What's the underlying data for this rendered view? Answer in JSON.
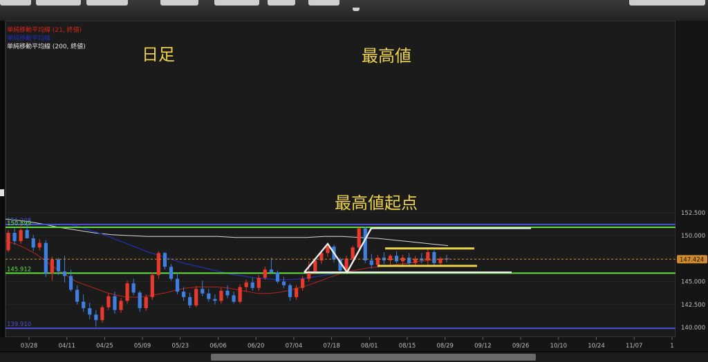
{
  "legend": [
    {
      "label": "単純移動平均線 (21, 終値)",
      "color": "#d9261c"
    },
    {
      "label": "単純移動平均線",
      "color": "#2230b8"
    },
    {
      "label": "単純移動平均線 (200, 終値)",
      "color": "#e6e6e6"
    }
  ],
  "annotations": {
    "timeframe": "日足",
    "high": "最高値",
    "high_origin": "最高値起点"
  },
  "colors": {
    "up": "#e8392d",
    "down": "#3f7fe0",
    "annotation": "#ecd24a",
    "level_green": "#5fe03c",
    "level_blue": "#4a4fd8"
  },
  "chart_data": {
    "type": "candlestick",
    "ylim": [
      139.9,
      152.5
    ],
    "y_ticks": [
      "152.500",
      "150.000",
      "147.500",
      "145.000",
      "142.500",
      "140.000"
    ],
    "x_ticks": [
      "03/28",
      "04/11",
      "04/25",
      "05/09",
      "05/23",
      "06/06",
      "06/20",
      "07/04",
      "07/18",
      "08/01",
      "08/15",
      "08/29",
      "09/12",
      "09/26",
      "10/10",
      "10/24",
      "11/07",
      "1"
    ],
    "last_price": "147.424",
    "levels": [
      {
        "value": 151.208,
        "label": "151.208",
        "color": "#4a4fd8"
      },
      {
        "value": 150.899,
        "label": "150.899",
        "color": "#5fe03c"
      },
      {
        "value": 145.912,
        "label": "145.912",
        "color": "#5fe03c"
      },
      {
        "value": 139.91,
        "label": "139.910",
        "color": "#4a4fd8"
      }
    ],
    "candles": [
      [
        148.4,
        150.6,
        148.2,
        150.3
      ],
      [
        150.3,
        150.8,
        149.0,
        149.4
      ],
      [
        149.4,
        151.1,
        149.1,
        150.6
      ],
      [
        150.6,
        151.2,
        149.7,
        149.7
      ],
      [
        149.7,
        150.1,
        148.3,
        148.7
      ],
      [
        148.7,
        149.6,
        148.4,
        149.2
      ],
      [
        149.2,
        149.5,
        145.5,
        145.9
      ],
      [
        145.9,
        147.7,
        145.1,
        147.4
      ],
      [
        147.4,
        147.6,
        145.7,
        146.1
      ],
      [
        146.1,
        147.8,
        144.9,
        145.6
      ],
      [
        145.6,
        146.3,
        143.9,
        144.1
      ],
      [
        144.1,
        144.6,
        142.5,
        142.8
      ],
      [
        142.8,
        143.6,
        141.7,
        142.1
      ],
      [
        142.1,
        142.7,
        140.9,
        141.4
      ],
      [
        141.4,
        141.9,
        140.1,
        140.8
      ],
      [
        140.8,
        142.4,
        140.5,
        142.2
      ],
      [
        142.2,
        143.7,
        141.9,
        143.4
      ],
      [
        143.4,
        143.9,
        141.5,
        141.9
      ],
      [
        141.9,
        143.2,
        141.6,
        142.9
      ],
      [
        142.9,
        145.1,
        142.6,
        144.8
      ],
      [
        144.8,
        145.3,
        143.5,
        143.8
      ],
      [
        143.8,
        144.0,
        141.7,
        142.1
      ],
      [
        142.1,
        143.6,
        141.8,
        143.3
      ],
      [
        143.3,
        146.0,
        143.0,
        145.7
      ],
      [
        145.7,
        148.3,
        145.3,
        148.1
      ],
      [
        148.1,
        148.2,
        146.3,
        146.6
      ],
      [
        146.6,
        146.9,
        145.1,
        145.3
      ],
      [
        145.3,
        145.9,
        143.6,
        143.9
      ],
      [
        143.9,
        144.4,
        142.9,
        143.3
      ],
      [
        143.3,
        143.8,
        142.1,
        142.4
      ],
      [
        142.4,
        144.5,
        142.2,
        144.2
      ],
      [
        144.2,
        145.1,
        143.4,
        143.7
      ],
      [
        143.7,
        144.2,
        142.8,
        143.1
      ],
      [
        143.1,
        143.6,
        142.5,
        142.9
      ],
      [
        142.9,
        144.3,
        142.6,
        144.0
      ],
      [
        144.0,
        144.6,
        143.2,
        143.5
      ],
      [
        143.5,
        143.9,
        142.6,
        142.8
      ],
      [
        142.8,
        144.7,
        142.6,
        144.4
      ],
      [
        144.4,
        145.2,
        143.9,
        144.9
      ],
      [
        144.9,
        145.4,
        144.0,
        144.3
      ],
      [
        144.3,
        145.7,
        144.0,
        145.4
      ],
      [
        145.4,
        146.6,
        145.2,
        146.3
      ],
      [
        146.3,
        147.6,
        145.9,
        146.0
      ],
      [
        146.0,
        146.2,
        144.8,
        145.0
      ],
      [
        145.0,
        145.5,
        144.3,
        144.6
      ],
      [
        144.6,
        144.8,
        142.9,
        143.3
      ],
      [
        143.3,
        144.6,
        143.0,
        144.3
      ],
      [
        144.3,
        145.6,
        144.0,
        145.3
      ],
      [
        145.3,
        147.2,
        145.0,
        146.1
      ],
      [
        146.1,
        147.6,
        145.8,
        147.3
      ],
      [
        147.3,
        148.4,
        146.9,
        148.1
      ],
      [
        148.1,
        149.2,
        147.7,
        148.8
      ],
      [
        148.8,
        149.0,
        147.1,
        147.4
      ],
      [
        147.4,
        147.6,
        145.9,
        146.2
      ],
      [
        146.2,
        147.8,
        146.0,
        147.5
      ],
      [
        147.5,
        148.9,
        147.2,
        148.7
      ],
      [
        148.7,
        150.9,
        148.4,
        150.8
      ],
      [
        150.8,
        151.0,
        147.0,
        147.3
      ],
      [
        147.3,
        148.0,
        146.4,
        146.8
      ],
      [
        146.8,
        147.9,
        146.5,
        147.6
      ],
      [
        147.6,
        148.2,
        146.9,
        147.3
      ],
      [
        147.3,
        148.0,
        146.6,
        147.8
      ],
      [
        147.8,
        148.3,
        147.0,
        147.2
      ],
      [
        147.2,
        147.9,
        146.6,
        147.6
      ],
      [
        147.6,
        148.1,
        146.8,
        147.0
      ],
      [
        147.0,
        147.8,
        146.7,
        147.5
      ],
      [
        147.5,
        148.1,
        147.0,
        147.3
      ],
      [
        147.3,
        148.5,
        146.6,
        148.2
      ],
      [
        148.2,
        148.4,
        146.7,
        147.0
      ],
      [
        147.0,
        147.7,
        146.8,
        147.5
      ],
      [
        147.5,
        147.9,
        147.1,
        147.4
      ]
    ],
    "sma21": [
      149.4,
      149.1,
      148.6,
      148.0,
      147.2,
      146.4,
      145.7,
      145.0,
      144.6,
      144.2,
      143.8,
      143.5,
      143.3,
      143.3,
      143.4,
      143.6,
      143.8,
      144.1,
      144.3,
      144.4,
      144.4,
      144.4,
      144.3,
      144.1,
      143.9,
      143.7,
      143.7,
      143.8,
      144.0,
      144.3,
      144.6,
      145.0,
      145.4,
      145.8,
      146.1,
      146.3,
      146.5,
      146.6,
      146.7,
      146.9,
      147.0,
      147.2,
      147.3,
      147.4,
      147.5
    ],
    "sma_blue": [
      151.3,
      151.0,
      150.6,
      150.2,
      149.7,
      149.2,
      148.7,
      148.2,
      147.8,
      147.4,
      147.0,
      146.7,
      146.4,
      146.1,
      145.8,
      145.6,
      145.4,
      145.3,
      145.2,
      145.2,
      145.3,
      145.5,
      145.7,
      145.9,
      146.1
    ],
    "sma200": [
      151.8,
      151.6,
      151.3,
      150.9,
      150.6,
      150.3,
      150.1,
      150.0,
      149.9,
      149.9,
      149.9,
      149.9,
      149.9,
      149.8,
      149.8,
      149.8,
      149.8,
      149.8,
      149.9,
      149.9,
      149.8,
      149.7,
      149.5,
      149.3,
      149.1,
      148.9
    ]
  }
}
